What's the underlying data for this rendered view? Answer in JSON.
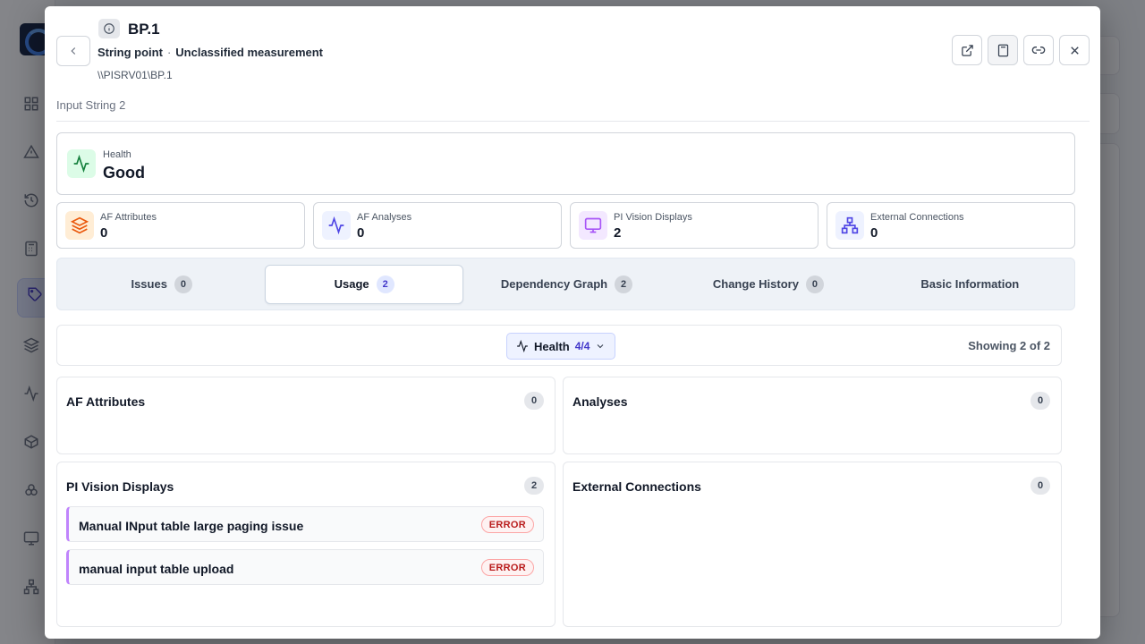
{
  "header": {
    "title": "BP.1",
    "point_type": "String point",
    "separator": "·",
    "measurement": "Unclassified measurement",
    "path": "\\\\PISRV01\\BP.1",
    "descriptor": "Input String 2",
    "actions": [
      "external-link-icon",
      "calculator-icon",
      "link-icon",
      "close-icon"
    ]
  },
  "health": {
    "label": "Health",
    "value": "Good",
    "color": "#15803d"
  },
  "stats": [
    {
      "label": "AF Attributes",
      "value": "0",
      "icon": "layers-icon",
      "color": "#ea580c"
    },
    {
      "label": "AF Analyses",
      "value": "0",
      "icon": "activity-icon",
      "color": "#4f46e5"
    },
    {
      "label": "PI Vision Displays",
      "value": "2",
      "icon": "monitor-icon",
      "color": "#a855f7"
    },
    {
      "label": "External Connections",
      "value": "0",
      "icon": "network-icon",
      "color": "#4f46e5"
    }
  ],
  "tabs": [
    {
      "label": "Issues",
      "count": "0"
    },
    {
      "label": "Usage",
      "count": "2"
    },
    {
      "label": "Dependency Graph",
      "count": "2"
    },
    {
      "label": "Change History",
      "count": "0"
    },
    {
      "label": "Basic Information",
      "count": ""
    }
  ],
  "active_tab": "Usage",
  "filter": {
    "label": "Health",
    "count": "4/4",
    "showing": "Showing 2 of 2"
  },
  "sections": {
    "af_attributes": {
      "title": "AF Attributes",
      "count": "0"
    },
    "analyses": {
      "title": "Analyses",
      "count": "0"
    },
    "pi_vision": {
      "title": "PI Vision Displays",
      "count": "2",
      "items": [
        {
          "name": "Manual INput table large paging issue",
          "status": "ERROR"
        },
        {
          "name": "manual input table upload",
          "status": "ERROR"
        }
      ]
    },
    "external": {
      "title": "External Connections",
      "count": "0"
    }
  }
}
